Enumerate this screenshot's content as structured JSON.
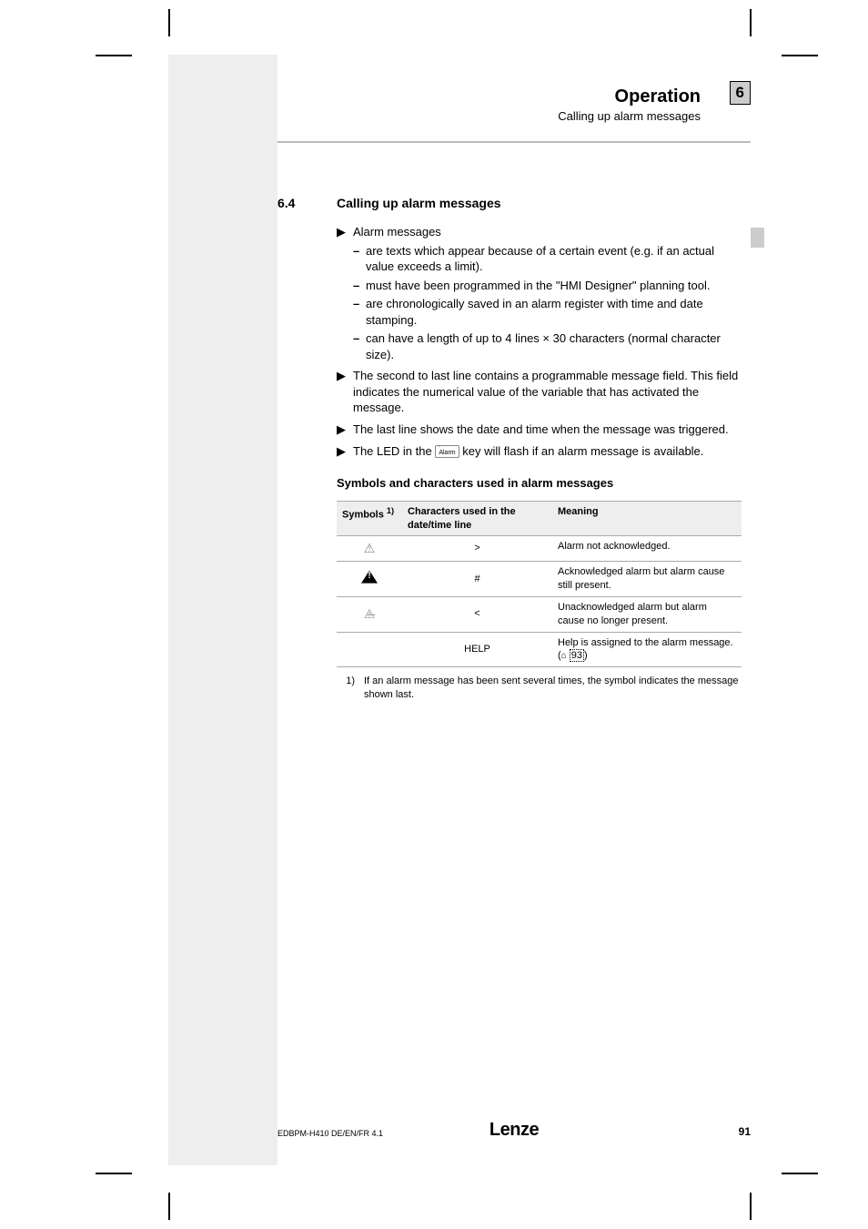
{
  "header": {
    "title": "Operation",
    "subtitle": "Calling up alarm messages",
    "chapter_badge": "6"
  },
  "section": {
    "number": "6.4",
    "title": "Calling up alarm messages"
  },
  "b1": {
    "mark": "▶",
    "text": "Alarm messages"
  },
  "d1": {
    "mark": "–",
    "text": "are texts which appear because of a certain event (e.g. if an actual value exceeds a limit)."
  },
  "d2": {
    "mark": "–",
    "text": "must have been programmed in the \"HMI Designer\" planning tool."
  },
  "d3": {
    "mark": "–",
    "text": "are chronologically saved in an alarm register with time and date stamping."
  },
  "d4": {
    "mark": "–",
    "text": "can have a length of up to 4 lines × 30 characters (normal character size)."
  },
  "b2": {
    "mark": "▶",
    "text": "The second to last line contains a programmable message field. This field indicates the numerical value of the variable that has activated the message."
  },
  "b3": {
    "mark": "▶",
    "text": "The last line shows the date and time when the message was triggered."
  },
  "b4": {
    "mark": "▶",
    "pre": "The LED in the ",
    "key": "Alarm",
    "post": " key will flash if an alarm message is available."
  },
  "subheading": "Symbols and characters used in alarm messages",
  "table": {
    "h1": "Symbols ",
    "h1sup": "1)",
    "h2": "Characters used in the date/time line",
    "h3": "Meaning",
    "r1": {
      "char": ">",
      "meaning": "Alarm not acknowledged."
    },
    "r2": {
      "char": "#",
      "meaning": "Acknowledged alarm but alarm cause still present."
    },
    "r3": {
      "char": "<",
      "meaning": "Unacknowledged alarm but alarm cause no longer present."
    },
    "r4": {
      "char": "HELP",
      "meaning_pre": "Help is assigned to the alarm message. (",
      "meaning_icon": "⌂",
      "meaning_ref": "93",
      "meaning_post": ")"
    }
  },
  "footnote": {
    "num": "1)",
    "text": "If an alarm message has been sent several times, the symbol indicates the message shown last."
  },
  "footer": {
    "left": "EDBPM-H410   DE/EN/FR   4.1",
    "center": "Lenze",
    "right": "91"
  }
}
